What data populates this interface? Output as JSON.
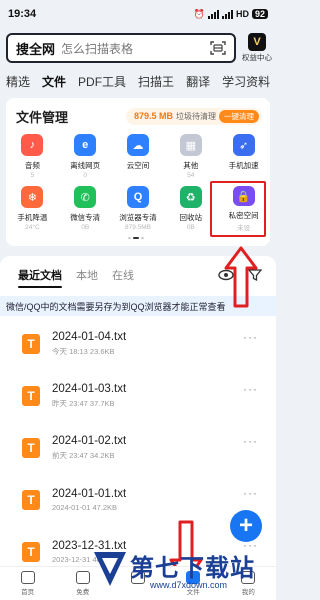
{
  "status": {
    "time": "19:34",
    "network": "HD",
    "battery": "92"
  },
  "search": {
    "brand": "搜全网",
    "placeholder": "怎么扫描表格",
    "vip_label": "权益中心",
    "vip_letter": "V"
  },
  "tabs": [
    "精选",
    "文件",
    "PDF工具",
    "扫描王",
    "翻译",
    "学习资料"
  ],
  "active_tab_index": 1,
  "file_manager": {
    "title": "文件管理",
    "junk_size": "879.5 MB",
    "junk_text": "垃圾待清理",
    "clean_label": "一键清理",
    "items": [
      {
        "label": "音频",
        "sub": "5",
        "icon": "music-icon",
        "color": "#ff5a4a",
        "glyph": "♪"
      },
      {
        "label": "离线网页",
        "sub": "0",
        "icon": "offline-web-icon",
        "color": "#2f80ff",
        "glyph": "e"
      },
      {
        "label": "云空间",
        "sub": "",
        "icon": "cloud-icon",
        "color": "#2f80ff",
        "glyph": "☁"
      },
      {
        "label": "其他",
        "sub": "54",
        "icon": "other-icon",
        "color": "#c4c8d4",
        "glyph": "▦"
      },
      {
        "label": "手机加速",
        "sub": "",
        "icon": "rocket-icon",
        "color": "#3a6df0",
        "glyph": "➶"
      },
      {
        "label": "手机降温",
        "sub": "24°C",
        "icon": "cooling-icon",
        "color": "#ff6a3d",
        "glyph": "❄"
      },
      {
        "label": "微信专清",
        "sub": "0B",
        "icon": "wechat-icon",
        "color": "#21c05a",
        "glyph": "✆"
      },
      {
        "label": "浏览器专清",
        "sub": "879.5MB",
        "icon": "browser-clean-icon",
        "color": "#2f80ff",
        "glyph": "Q"
      },
      {
        "label": "回收站",
        "sub": "0B",
        "icon": "recycle-icon",
        "color": "#1fb36a",
        "glyph": "♻"
      },
      {
        "label": "私密空间",
        "sub": "未设",
        "icon": "lock-icon",
        "color": "#7a4df2",
        "glyph": "🔒"
      }
    ]
  },
  "recent": {
    "tabs": [
      "最近文档",
      "本地",
      "在线"
    ],
    "notice": "微信/QQ中的文档需要另存为到QQ浏览器才能正常查看",
    "files": [
      {
        "name": "2024-01-04.txt",
        "meta": "今天 18:13  23.6KB"
      },
      {
        "name": "2024-01-03.txt",
        "meta": "昨天 23:47  37.7KB"
      },
      {
        "name": "2024-01-02.txt",
        "meta": "前天 23:47  34.2KB"
      },
      {
        "name": "2024-01-01.txt",
        "meta": "2024-01-01  47.2KB"
      },
      {
        "name": "2023-12-31.txt",
        "meta": "2023-12-31  48.6KB"
      }
    ],
    "more": "···",
    "file_icon_letter": "T"
  },
  "fab_label": "+",
  "bottom_nav": [
    "首页",
    "免费",
    "",
    "文件",
    "我的"
  ],
  "watermark": {
    "text": "第七下载站",
    "url": "www.d7xdown.com"
  }
}
